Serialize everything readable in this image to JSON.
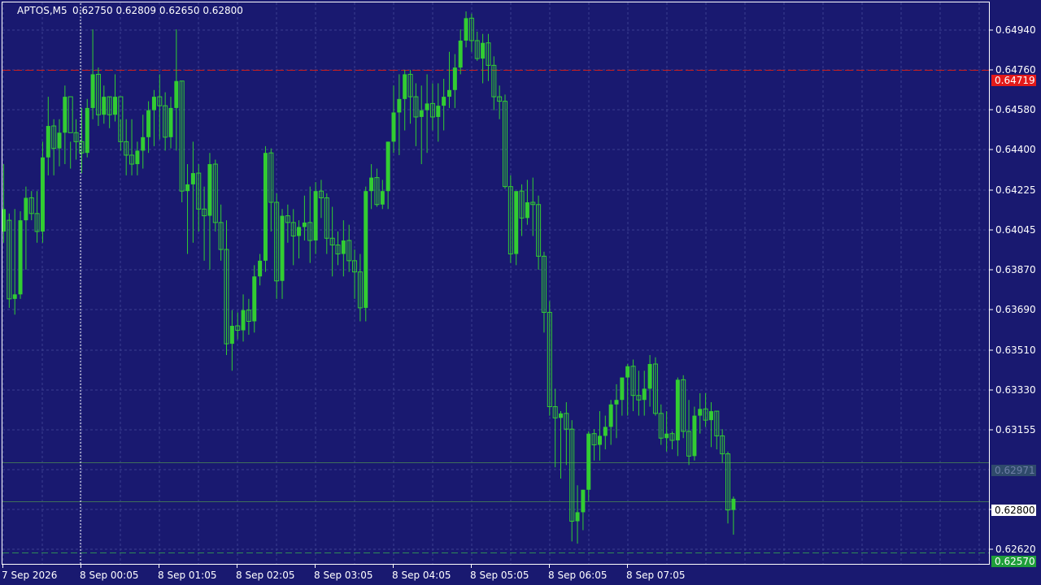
{
  "header": {
    "symbol": "APTOS,M5",
    "ohlc": "0.62750 0.62809 0.62650 0.62800"
  },
  "colors": {
    "background": "#191970",
    "grid": "#3a3f8f",
    "axis_text": "#ffffff",
    "bull": "#32cd32",
    "bear": "#32cd32",
    "ask_line": "#cc1e1e",
    "bid_line": "#2e8b57"
  },
  "price_labels": {
    "ask": "0.64719",
    "level_mid": "0.62971",
    "current": "0.62800",
    "bid": "0.62570"
  },
  "chart_data": {
    "type": "candlestick",
    "title": "",
    "ylim": [
      0.6252,
      0.6502
    ],
    "y_ticks": [
      "0.64940",
      "0.64760",
      "0.64580",
      "0.64400",
      "0.64225",
      "0.64045",
      "0.63870",
      "0.63690",
      "0.63510",
      "0.63330",
      "0.63155",
      "0.62975",
      "0.62800",
      "0.62620"
    ],
    "x_labels": [
      "7 Sep 2026",
      "8 Sep 00:05",
      "8 Sep 01:05",
      "8 Sep 02:05",
      "8 Sep 03:05",
      "8 Sep 04:05",
      "8 Sep 05:05",
      "8 Sep 06:05",
      "8 Sep 07:05"
    ],
    "horizontal_lines": [
      {
        "name": "ask",
        "price": 0.64719
      },
      {
        "name": "level",
        "price": 0.62971
      },
      {
        "name": "current",
        "price": 0.628
      },
      {
        "name": "bid",
        "price": 0.6257
      }
    ],
    "ohlc": [
      [
        0.64,
        0.643,
        0.6395,
        0.641
      ],
      [
        0.6405,
        0.6408,
        0.6366,
        0.637
      ],
      [
        0.637,
        0.641,
        0.6363,
        0.6372
      ],
      [
        0.6372,
        0.6409,
        0.637,
        0.6405
      ],
      [
        0.6405,
        0.642,
        0.6383,
        0.6415
      ],
      [
        0.6415,
        0.6418,
        0.6405,
        0.6408
      ],
      [
        0.6408,
        0.6418,
        0.6395,
        0.64
      ],
      [
        0.64,
        0.644,
        0.6395,
        0.6433
      ],
      [
        0.6433,
        0.646,
        0.6425,
        0.6447
      ],
      [
        0.6447,
        0.645,
        0.6425,
        0.6437
      ],
      [
        0.6437,
        0.645,
        0.6429,
        0.6444
      ],
      [
        0.6444,
        0.6465,
        0.643,
        0.646
      ],
      [
        0.646,
        0.644,
        0.6428,
        0.6444
      ],
      [
        0.6444,
        0.645,
        0.6432,
        0.644
      ],
      [
        0.644,
        0.6455,
        0.6426,
        0.6435
      ],
      [
        0.6435,
        0.6459,
        0.6433,
        0.6455
      ],
      [
        0.6455,
        0.649,
        0.645,
        0.647
      ],
      [
        0.647,
        0.6473,
        0.6447,
        0.6452
      ],
      [
        0.6452,
        0.6465,
        0.6448,
        0.646
      ],
      [
        0.646,
        0.646,
        0.6446,
        0.6452
      ],
      [
        0.6452,
        0.647,
        0.6449,
        0.646
      ],
      [
        0.646,
        0.645,
        0.6436,
        0.644
      ],
      [
        0.644,
        0.645,
        0.6425,
        0.6434
      ],
      [
        0.6434,
        0.645,
        0.6425,
        0.643
      ],
      [
        0.643,
        0.644,
        0.6425,
        0.6436
      ],
      [
        0.6436,
        0.6452,
        0.6428,
        0.6442
      ],
      [
        0.6442,
        0.6458,
        0.6435,
        0.6454
      ],
      [
        0.6454,
        0.6463,
        0.6438,
        0.646
      ],
      [
        0.646,
        0.647,
        0.6441,
        0.6456
      ],
      [
        0.6456,
        0.6462,
        0.6436,
        0.6442
      ],
      [
        0.6442,
        0.646,
        0.6437,
        0.6455
      ],
      [
        0.6455,
        0.649,
        0.6436,
        0.6467
      ],
      [
        0.6467,
        0.6467,
        0.6413,
        0.6418
      ],
      [
        0.6418,
        0.643,
        0.639,
        0.6421
      ],
      [
        0.6421,
        0.644,
        0.6395,
        0.6426
      ],
      [
        0.6426,
        0.643,
        0.64,
        0.641
      ],
      [
        0.641,
        0.642,
        0.6387,
        0.6407
      ],
      [
        0.6407,
        0.6435,
        0.6383,
        0.643
      ],
      [
        0.643,
        0.6432,
        0.64,
        0.6404
      ],
      [
        0.6404,
        0.6412,
        0.6387,
        0.6392
      ],
      [
        0.6392,
        0.6405,
        0.6345,
        0.635
      ],
      [
        0.635,
        0.6365,
        0.6338,
        0.6358
      ],
      [
        0.6358,
        0.6364,
        0.6352,
        0.6356
      ],
      [
        0.6356,
        0.6372,
        0.6351,
        0.6365
      ],
      [
        0.6365,
        0.637,
        0.6354,
        0.636
      ],
      [
        0.636,
        0.6385,
        0.6355,
        0.638
      ],
      [
        0.638,
        0.639,
        0.6376,
        0.6387
      ],
      [
        0.6387,
        0.6438,
        0.6382,
        0.6435
      ],
      [
        0.6435,
        0.6437,
        0.64,
        0.6413
      ],
      [
        0.6413,
        0.6417,
        0.637,
        0.6378
      ],
      [
        0.6378,
        0.641,
        0.637,
        0.6407
      ],
      [
        0.6407,
        0.6412,
        0.6395,
        0.6404
      ],
      [
        0.6404,
        0.641,
        0.6385,
        0.6398
      ],
      [
        0.6398,
        0.6405,
        0.6388,
        0.6402
      ],
      [
        0.6402,
        0.6416,
        0.6396,
        0.6404
      ],
      [
        0.6404,
        0.642,
        0.6386,
        0.6396
      ],
      [
        0.6396,
        0.6422,
        0.639,
        0.6418
      ],
      [
        0.6418,
        0.6423,
        0.6406,
        0.6415
      ],
      [
        0.6415,
        0.6417,
        0.639,
        0.6397
      ],
      [
        0.6397,
        0.6411,
        0.638,
        0.6394
      ],
      [
        0.6394,
        0.64,
        0.6385,
        0.639
      ],
      [
        0.639,
        0.6405,
        0.638,
        0.6396
      ],
      [
        0.6396,
        0.6403,
        0.6382,
        0.6387
      ],
      [
        0.6387,
        0.6392,
        0.637,
        0.6382
      ],
      [
        0.6382,
        0.639,
        0.636,
        0.6366
      ],
      [
        0.6366,
        0.642,
        0.636,
        0.6418
      ],
      [
        0.6418,
        0.643,
        0.641,
        0.6424
      ],
      [
        0.6424,
        0.6428,
        0.6411,
        0.6412
      ],
      [
        0.6412,
        0.6423,
        0.641,
        0.6418
      ],
      [
        0.6418,
        0.644,
        0.641,
        0.644
      ],
      [
        0.644,
        0.6465,
        0.6435,
        0.6453
      ],
      [
        0.6453,
        0.647,
        0.6434,
        0.6459
      ],
      [
        0.6459,
        0.6472,
        0.6445,
        0.647
      ],
      [
        0.647,
        0.6472,
        0.6448,
        0.646
      ],
      [
        0.646,
        0.6466,
        0.6438,
        0.6451
      ],
      [
        0.6451,
        0.6465,
        0.643,
        0.6454
      ],
      [
        0.6454,
        0.647,
        0.6435,
        0.6457
      ],
      [
        0.6457,
        0.6466,
        0.6445,
        0.6451
      ],
      [
        0.6451,
        0.6466,
        0.644,
        0.6456
      ],
      [
        0.6456,
        0.6468,
        0.6445,
        0.646
      ],
      [
        0.646,
        0.648,
        0.6455,
        0.6463
      ],
      [
        0.6463,
        0.6479,
        0.6455,
        0.6473
      ],
      [
        0.6473,
        0.649,
        0.647,
        0.6485
      ],
      [
        0.6485,
        0.6498,
        0.6482,
        0.6495
      ],
      [
        0.6495,
        0.6497,
        0.648,
        0.6485
      ],
      [
        0.6485,
        0.6489,
        0.6476,
        0.6477
      ],
      [
        0.6477,
        0.6488,
        0.6466,
        0.6484
      ],
      [
        0.6484,
        0.6488,
        0.6467,
        0.6474
      ],
      [
        0.6474,
        0.6478,
        0.6454,
        0.646
      ],
      [
        0.646,
        0.6465,
        0.645,
        0.6458
      ],
      [
        0.6458,
        0.6461,
        0.6419,
        0.642
      ],
      [
        0.642,
        0.6425,
        0.6386,
        0.639
      ],
      [
        0.639,
        0.6414,
        0.6385,
        0.6418
      ],
      [
        0.6418,
        0.6421,
        0.6398,
        0.6406
      ],
      [
        0.6406,
        0.6423,
        0.6403,
        0.6413
      ],
      [
        0.6413,
        0.6424,
        0.6398,
        0.6412
      ],
      [
        0.6412,
        0.6416,
        0.6383,
        0.6389
      ],
      [
        0.6389,
        0.6391,
        0.6355,
        0.6364
      ],
      [
        0.6364,
        0.6369,
        0.6318,
        0.6322
      ],
      [
        0.6322,
        0.633,
        0.6295,
        0.6317
      ],
      [
        0.6317,
        0.632,
        0.629,
        0.6319
      ],
      [
        0.6319,
        0.6324,
        0.6296,
        0.6312
      ],
      [
        0.6312,
        0.6316,
        0.6262,
        0.6271
      ],
      [
        0.6271,
        0.6287,
        0.6261,
        0.6275
      ],
      [
        0.6275,
        0.6285,
        0.6267,
        0.6285
      ],
      [
        0.6285,
        0.6311,
        0.628,
        0.631
      ],
      [
        0.631,
        0.6312,
        0.6298,
        0.6305
      ],
      [
        0.6305,
        0.632,
        0.6298,
        0.6309
      ],
      [
        0.6309,
        0.6318,
        0.6303,
        0.6313
      ],
      [
        0.6313,
        0.6325,
        0.6305,
        0.6323
      ],
      [
        0.6323,
        0.6332,
        0.6308,
        0.6325
      ],
      [
        0.6325,
        0.6334,
        0.6318,
        0.6335
      ],
      [
        0.6335,
        0.6341,
        0.6318,
        0.634
      ],
      [
        0.634,
        0.6343,
        0.632,
        0.6327
      ],
      [
        0.6327,
        0.6338,
        0.6318,
        0.6325
      ],
      [
        0.6325,
        0.6338,
        0.6318,
        0.633
      ],
      [
        0.633,
        0.6345,
        0.6322,
        0.6341
      ],
      [
        0.6341,
        0.6344,
        0.6318,
        0.6319
      ],
      [
        0.6319,
        0.6323,
        0.6305,
        0.6308
      ],
      [
        0.6308,
        0.632,
        0.6302,
        0.631
      ],
      [
        0.631,
        0.6311,
        0.6303,
        0.6307
      ],
      [
        0.6307,
        0.6335,
        0.63,
        0.6334
      ],
      [
        0.6334,
        0.6336,
        0.6308,
        0.6311
      ],
      [
        0.6311,
        0.6325,
        0.6296,
        0.63
      ],
      [
        0.63,
        0.6322,
        0.6298,
        0.6318
      ],
      [
        0.6318,
        0.6328,
        0.631,
        0.6321
      ],
      [
        0.6321,
        0.6328,
        0.6313,
        0.6316
      ],
      [
        0.6316,
        0.6324,
        0.6304,
        0.632
      ],
      [
        0.632,
        0.632,
        0.6303,
        0.6309
      ],
      [
        0.6309,
        0.6312,
        0.6297,
        0.6301
      ],
      [
        0.6301,
        0.6302,
        0.627,
        0.6276
      ],
      [
        0.6276,
        0.6282,
        0.6265,
        0.6281
      ]
    ]
  }
}
